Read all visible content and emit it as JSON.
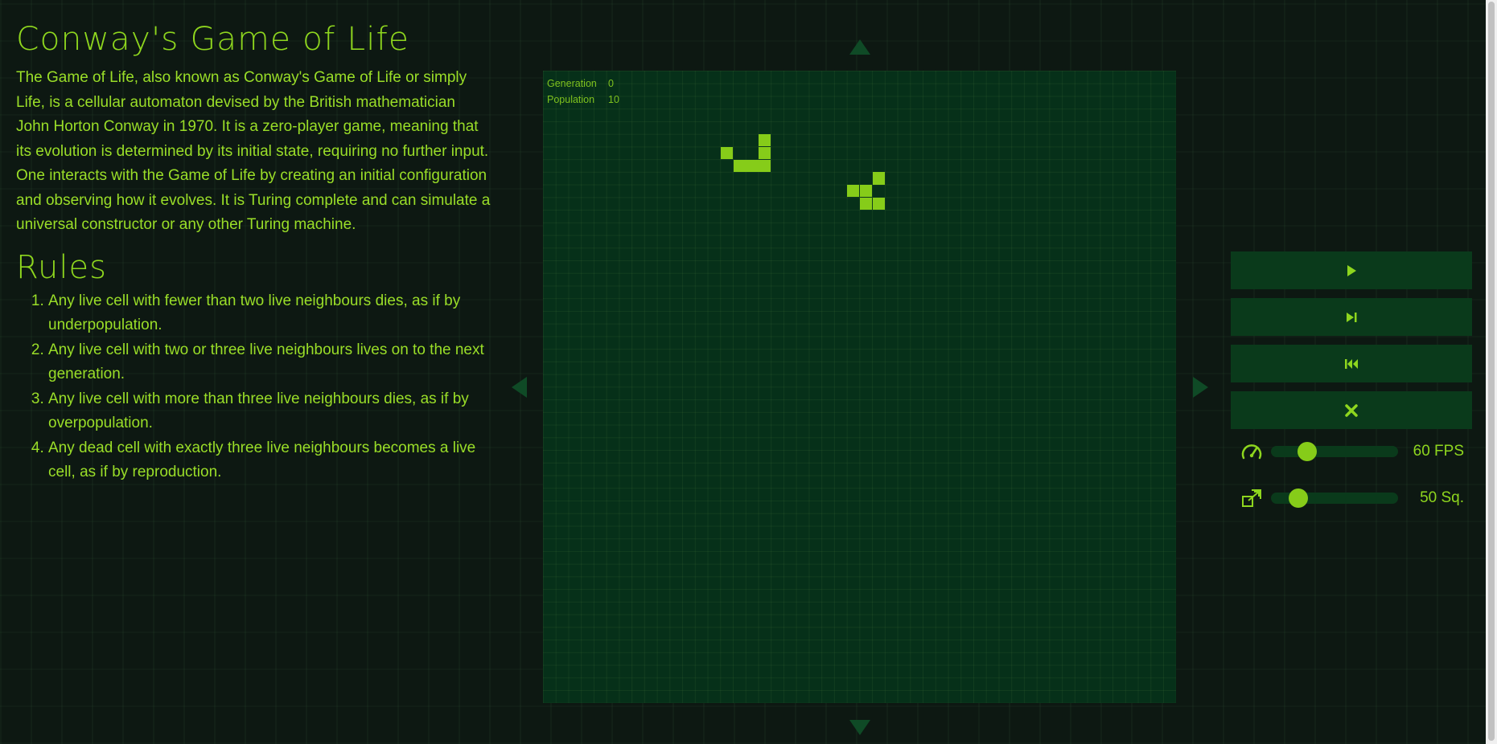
{
  "title": "Conway's Game of Life",
  "intro": "The Game of Life, also known as Conway's Game of Life or simply Life, is a cellular automaton devised by the British mathematician John Horton Conway in 1970. It is a zero-player game, meaning that its evolution is determined by its initial state, requiring no further input. One interacts with the Game of Life by creating an initial configuration and observing how it evolves. It is Turing complete and can simulate a universal constructor or any other Turing machine.",
  "rules": {
    "heading": "Rules",
    "items": [
      "Any live cell with fewer than two live neighbours dies, as if by underpopulation.",
      "Any live cell with two or three live neighbours lives on to the next generation.",
      "Any live cell with more than three live neighbours dies, as if by overpopulation.",
      "Any dead cell with exactly three live neighbours becomes a live cell, as if by reproduction."
    ]
  },
  "stats": {
    "generation_label": "Generation",
    "generation_value": "0",
    "population_label": "Population",
    "population_value": "10"
  },
  "board": {
    "grid_size": 50,
    "live_cells": [
      [
        17,
        5
      ],
      [
        17,
        6
      ],
      [
        17,
        7
      ],
      [
        16,
        7
      ],
      [
        15,
        7
      ],
      [
        14,
        6
      ],
      [
        26,
        8
      ],
      [
        25,
        9
      ],
      [
        24,
        9
      ],
      [
        25,
        10
      ],
      [
        26,
        10
      ]
    ]
  },
  "controls": {
    "buttons": [
      {
        "name": "play",
        "icon": "play-icon"
      },
      {
        "name": "step",
        "icon": "step-forward-icon"
      },
      {
        "name": "reset",
        "icon": "skip-back-icon"
      },
      {
        "name": "clear",
        "icon": "close-icon"
      }
    ],
    "speed": {
      "icon": "speedometer-icon",
      "value": 60,
      "min": 1,
      "max": 240,
      "label": "60 FPS"
    },
    "size": {
      "icon": "resize-icon",
      "value": 50,
      "min": 10,
      "max": 250,
      "label": "50 Sq."
    }
  },
  "colors": {
    "accent": "#86cc19",
    "panel": "#0a3a1b",
    "board": "#063019",
    "background": "#0d1812"
  }
}
